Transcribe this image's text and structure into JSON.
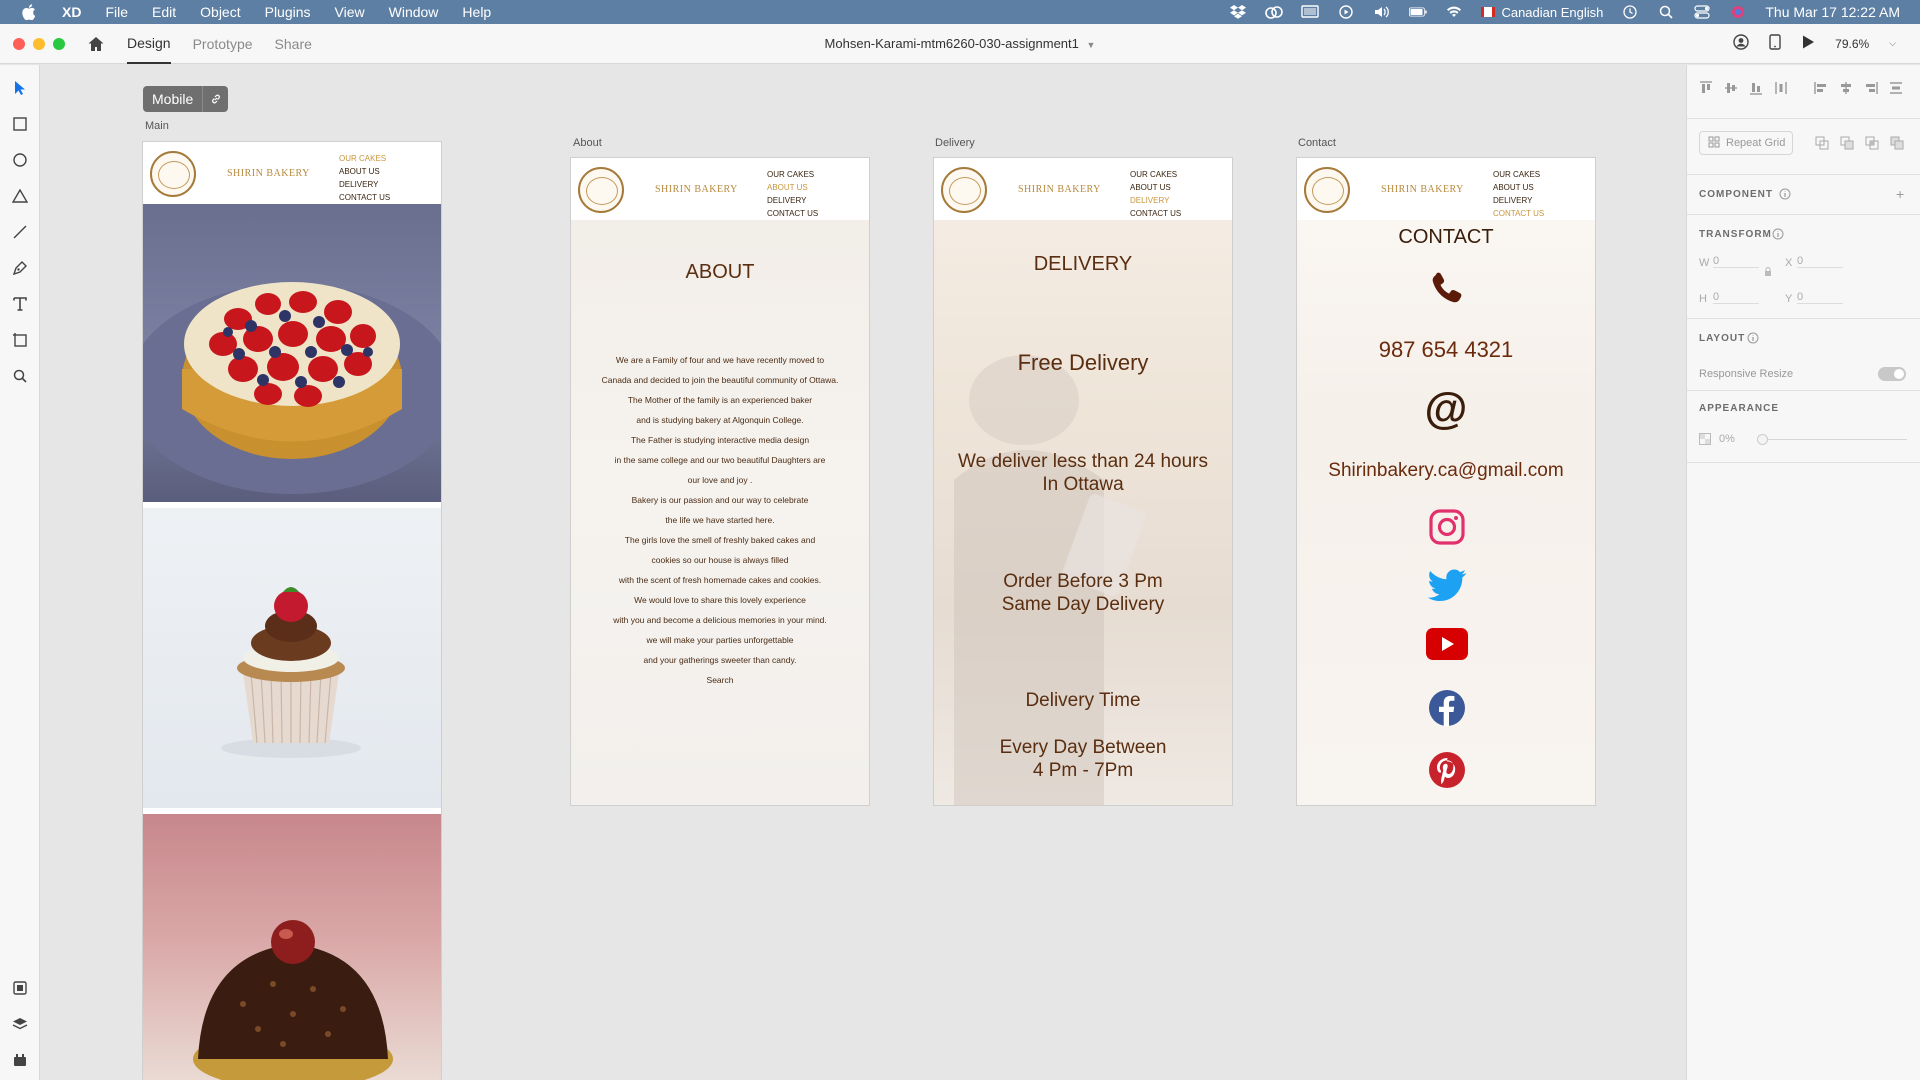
{
  "menubar": {
    "app_name": "XD",
    "menus": [
      "File",
      "Edit",
      "Object",
      "Plugins",
      "View",
      "Window",
      "Help"
    ],
    "language": "Canadian English",
    "datetime": "Thu Mar 17  12:22 AM"
  },
  "titlebar": {
    "tabs": [
      "Design",
      "Prototype",
      "Share"
    ],
    "document_title": "Mohsen-Karami-mtm6260-030-assignment1",
    "zoom": "79.6%"
  },
  "canvas": {
    "mobile_badge": "Mobile",
    "labels": {
      "main": "Main",
      "about": "About",
      "delivery": "Delivery",
      "contact": "Contact"
    }
  },
  "site": {
    "brand": "SHIRIN BAKERY",
    "nav": [
      "OUR CAKES",
      "ABOUT US",
      "DELIVERY",
      "CONTACT US"
    ]
  },
  "about": {
    "title": "ABOUT",
    "lines": [
      "We are a Family of four and we have recently moved to",
      "Canada and decided to join the beautiful community of Ottawa.",
      "The Mother of the family is an experienced baker",
      "and is studying bakery at Algonquin College.",
      "The Father is studying interactive media design",
      "in the same college and our two beautiful Daughters are",
      "our love and joy .",
      "Bakery is our passion and our way to celebrate",
      "the life we have started here.",
      "The girls love the smell of freshly baked cakes and",
      "cookies so our house is always filled",
      "with the scent of fresh homemade cakes and cookies.",
      "We would love to share this lovely experience",
      "with you and become a delicious memories in your mind.",
      "we will make your parties unforgettable",
      "and your gatherings sweeter than candy.",
      "Search"
    ]
  },
  "delivery": {
    "title": "DELIVERY",
    "free": "Free Delivery",
    "line1": "We deliver less than 24 hours",
    "line2": "In Ottawa",
    "line3": "Order Before 3 Pm",
    "line4": "Same Day Delivery",
    "line5": "Delivery Time",
    "line6": "Every Day Between",
    "line7": "4 Pm - 7Pm"
  },
  "contact": {
    "title": "CONTACT",
    "phone": "987 654 4321",
    "at": "@",
    "email": "Shirinbakery.ca@gmail.com"
  },
  "panel": {
    "repeat_grid": "Repeat Grid",
    "component": "COMPONENT",
    "transform": "TRANSFORM",
    "w_label": "W",
    "w_value": "0",
    "x_label": "X",
    "x_value": "0",
    "h_label": "H",
    "h_value": "0",
    "y_label": "Y",
    "y_value": "0",
    "layout": "LAYOUT",
    "responsive_resize": "Responsive Resize",
    "appearance": "APPEARANCE",
    "opacity": "0%"
  },
  "colors": {
    "menubar": "#5d7fa3",
    "accent_gold": "#c9963c",
    "brown_text": "#5a2e10",
    "instagram": "#e1306c",
    "twitter": "#1da1f2",
    "youtube": "#d60000",
    "facebook": "#3b5998",
    "pinterest": "#c8232c"
  }
}
